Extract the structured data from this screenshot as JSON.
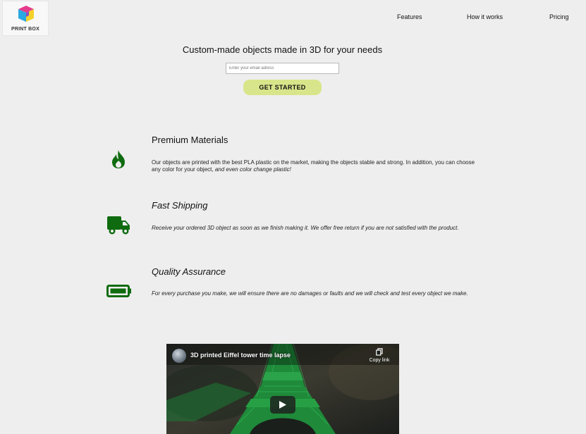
{
  "header": {
    "logo_text": "PRINT BOX",
    "nav": [
      "Features",
      "How it works",
      "Pricing"
    ]
  },
  "hero": {
    "title": "Custom-made objects made in 3D for your needs",
    "email_placeholder": "Enter your email adress",
    "cta_label": "GET STARTED"
  },
  "features": [
    {
      "icon": "flame-icon",
      "title": "Premium Materials",
      "description_main": "Our objects are printed with the best PLA plastic on the market, making the objects stable and strong. In addition, you can choose any color for your object,",
      "description_emphasis": " and even color change plastic!"
    },
    {
      "icon": "truck-icon",
      "title": "Fast Shipping",
      "description": "Receive your ordered 3D object as soon as we finish making it. We offer free return if you are not satisfied with the product."
    },
    {
      "icon": "battery-icon",
      "title": "Quality Assurance",
      "description": "For every purchase you make, we will ensure there are no damages or faults and we will check and test every object we make."
    }
  ],
  "video": {
    "title": "3D printed Eiffel tower time lapse",
    "copy_link_label": "Copy link"
  },
  "colors": {
    "background": "#eeeeee",
    "accent_button": "#d9e58a",
    "icon_green": "#0f6b0f"
  }
}
